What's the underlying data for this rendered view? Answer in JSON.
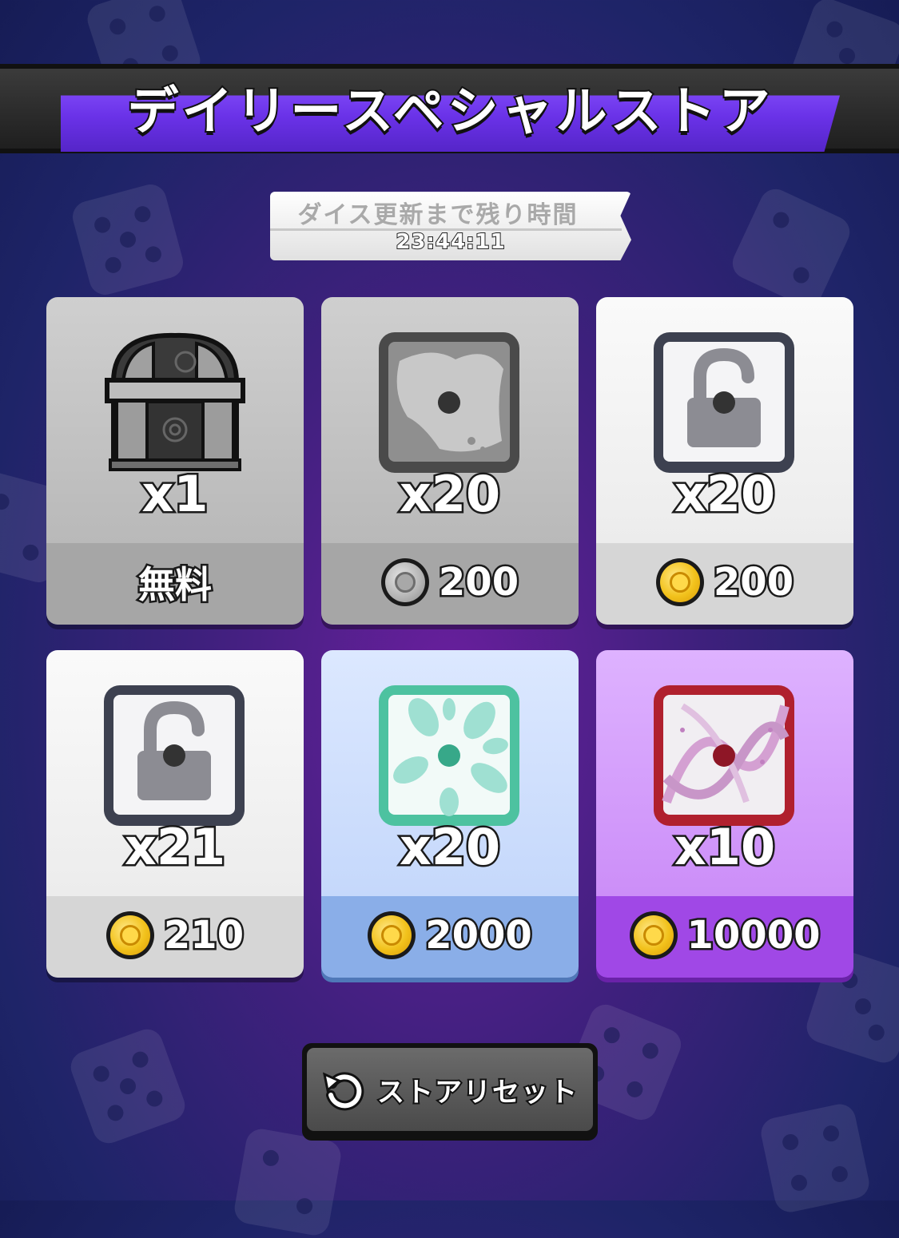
{
  "header": {
    "title": "デイリースペシャルストア"
  },
  "timer": {
    "label": "ダイス更新まで残り時間",
    "value": "23:44:11"
  },
  "cards": [
    {
      "item": "chest-icon",
      "quantity": "x1",
      "price": "無料",
      "currency": "none",
      "style": "gray"
    },
    {
      "item": "smoke-dice-icon",
      "quantity": "x20",
      "price": "200",
      "currency": "silver-coin-icon",
      "style": "gray"
    },
    {
      "item": "lock-dice-icon",
      "quantity": "x20",
      "price": "200",
      "currency": "gold-coin-icon",
      "style": "white"
    },
    {
      "item": "lock-dice-icon",
      "quantity": "x21",
      "price": "210",
      "currency": "gold-coin-icon",
      "style": "white"
    },
    {
      "item": "wind-dice-icon",
      "quantity": "x20",
      "price": "2000",
      "currency": "gold-coin-icon",
      "style": "blue"
    },
    {
      "item": "dna-dice-icon",
      "quantity": "x10",
      "price": "10000",
      "currency": "gold-coin-icon",
      "style": "purple"
    }
  ],
  "reset_button": {
    "label": "ストアリセット",
    "icon": "refresh-icon"
  },
  "colors": {
    "banner": "#6a32e8",
    "gold_coin": "#f2c21c",
    "card_blue": "#c5d8fb",
    "card_purple": "#cc8ef8"
  }
}
